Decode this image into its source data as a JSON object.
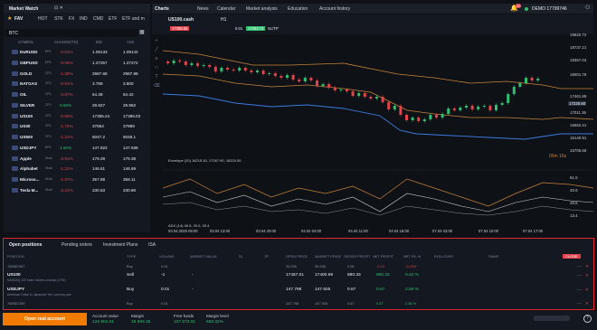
{
  "market_watch": {
    "title": "Market Watch",
    "tabs": [
      "FAV",
      "HOT",
      "STK",
      "FX",
      "IND",
      "CMD",
      "ETF",
      "ETF and m"
    ],
    "search": "BTC",
    "columns": [
      "SYMBOL",
      "CHANGE(TD)",
      "BID",
      "ASK"
    ],
    "rows": [
      {
        "symbol": "EURUSD",
        "tag": "EPS",
        "change": "-0.01%",
        "bid": "1.09133",
        "ask": "1.09142",
        "dir": "neg"
      },
      {
        "symbol": "GBPUSD",
        "tag": "EPS",
        "change": "-0.06%",
        "bid": "1.27257",
        "ask": "1.27272",
        "dir": "neg"
      },
      {
        "symbol": "GOLD",
        "tag": "CFD",
        "change": "-1.35%",
        "bid": "2987.68",
        "ask": "2987.98",
        "dir": "neg"
      },
      {
        "symbol": "NATGAS",
        "tag": "CFD",
        "change": "-0.91%",
        "bid": "3.789",
        "ask": "3.800",
        "dir": "neg"
      },
      {
        "symbol": "OIL",
        "tag": "CFD",
        "change": "-3.87%",
        "bid": "64.38",
        "ask": "64.42",
        "dir": "neg"
      },
      {
        "symbol": "SILVER",
        "tag": "CFD",
        "change": "0.69%",
        "bid": "29.927",
        "ask": "29.962",
        "dir": "pos"
      },
      {
        "symbol": "US100",
        "tag": "CFD",
        "change": "-0.80%",
        "bid": "17395.24",
        "ask": "17399.03",
        "dir": "neg"
      },
      {
        "symbol": "US30",
        "tag": "CFD",
        "change": "-1.72%",
        "bid": "37864",
        "ask": "37889",
        "dir": "neg"
      },
      {
        "symbol": "US500",
        "tag": "CFD",
        "change": "-1.21%",
        "bid": "5047.2",
        "ask": "5048.1",
        "dir": "neg"
      },
      {
        "symbol": "USDJPY",
        "tag": "EPS",
        "change": "1.60%",
        "bid": "147.922",
        "ask": "147.939",
        "dir": "pos"
      },
      {
        "symbol": "Apple",
        "tag": "Stock",
        "change": "-3.91%",
        "bid": "179.28",
        "ask": "179.38",
        "dir": "neg"
      },
      {
        "symbol": "Alphabet",
        "tag": "Stock",
        "change": "-1.31%",
        "bid": "146.61",
        "ask": "146.69",
        "dir": "neg"
      },
      {
        "symbol": "Microso...",
        "tag": "Stock",
        "change": "-1.97%",
        "bid": "357.89",
        "ask": "358.11",
        "dir": "neg"
      },
      {
        "symbol": "Tesla M...",
        "tag": "Stock",
        "change": "-3.21%",
        "bid": "230.63",
        "ask": "230.90",
        "dir": "neg"
      }
    ]
  },
  "top_nav": {
    "charts": "Charts",
    "tabs": [
      "News",
      "Calendar",
      "Market analysis",
      "Education",
      "Account history"
    ],
    "account": "DEMO 17799746",
    "badge": "20"
  },
  "chart_toolbar": {
    "symbol": "US100.cash",
    "timeframe": "H1",
    "sell": "17285.65",
    "qty": "0.01",
    "buy": "17292.74",
    "sltp": "SL/TP"
  },
  "chart_data": [
    {
      "type": "line",
      "symbol": "US100",
      "timeframe": "H1",
      "y_axis": [
        "19622.72",
        "18737.21",
        "18357.04",
        "18001.78",
        "17461.89",
        "17220.60",
        "17011.36",
        "16662.41",
        "16140.91",
        "15705.66"
      ],
      "last_price": "17220.60",
      "countdown": "00m 16s",
      "indicator": "Envelope (20) 18215.30, 17267.90, 16320.50"
    },
    {
      "type": "line",
      "indicator": "ADX (14) 46.5, 29.0, 33.4",
      "y_axis": [
        "61.6",
        "40.6",
        "26.6",
        "13.4"
      ]
    }
  ],
  "x_axis": [
    "03.04.2025 06:00",
    "03.04 13:00",
    "03.04 20:00",
    "04.04 04:00",
    "04.04 11:00",
    "04.04 18:00",
    "07.04 03:00",
    "07.04 10:00",
    "07.04 17:00"
  ],
  "positions": {
    "tabs": [
      "Open positions",
      "Pending orders",
      "Investment Plans",
      "ISA"
    ],
    "columns": [
      "POSITION",
      "TYPE",
      "VOLUME",
      "MARKET VALUE",
      "SL",
      "TP",
      "OPEN PRICE",
      "MARKET PRICE",
      "GROSS PROFIT",
      "NET PROFIT",
      "NET P/L %",
      "ROLLOVER",
      "SWAP"
    ],
    "close_label": "CLOSE",
    "rows": [
      {
        "position": "765567907",
        "type": "Buy",
        "volume": "0.01",
        "market_value": "",
        "open": "39.926",
        "market": "39.936",
        "gross": "0.06",
        "net": "-0.13",
        "pl": "-0.03%",
        "sub": true
      },
      {
        "position": "US100",
        "desc": "NASDAQ 100 index futures contract (CFD)",
        "type": "Sell",
        "volume": "-1",
        "market_value": "-",
        "open": "17457.01",
        "market": "17400.99",
        "gross": "880.33",
        "net": "880.33",
        "pl": "0.42 %",
        "sub": false
      },
      {
        "position": "USDJPY",
        "desc": "American Dollar to Japanese Yen currency pair",
        "type": "Buy",
        "volume": "0.01",
        "market_value": "-",
        "open": "147.798",
        "market": "147.925",
        "gross": "0.67",
        "net": "0.67",
        "pl": "2.56 %",
        "sub": false
      },
      {
        "position": "765567259",
        "type": "Buy",
        "volume": "0.01",
        "market_value": "",
        "open": "147.798",
        "market": "147.925",
        "gross": "0.67",
        "net": "0.67",
        "pl": "2.56 %",
        "sub": true
      }
    ]
  },
  "footer": {
    "open_account": "Open real account",
    "stats": [
      {
        "label": "Account value",
        "value": "126 904.01"
      },
      {
        "label": "Margin",
        "value": "18 993.35"
      },
      {
        "label": "Free funds",
        "value": "107 573.31"
      },
      {
        "label": "Margin level",
        "value": "668.32%"
      }
    ]
  }
}
